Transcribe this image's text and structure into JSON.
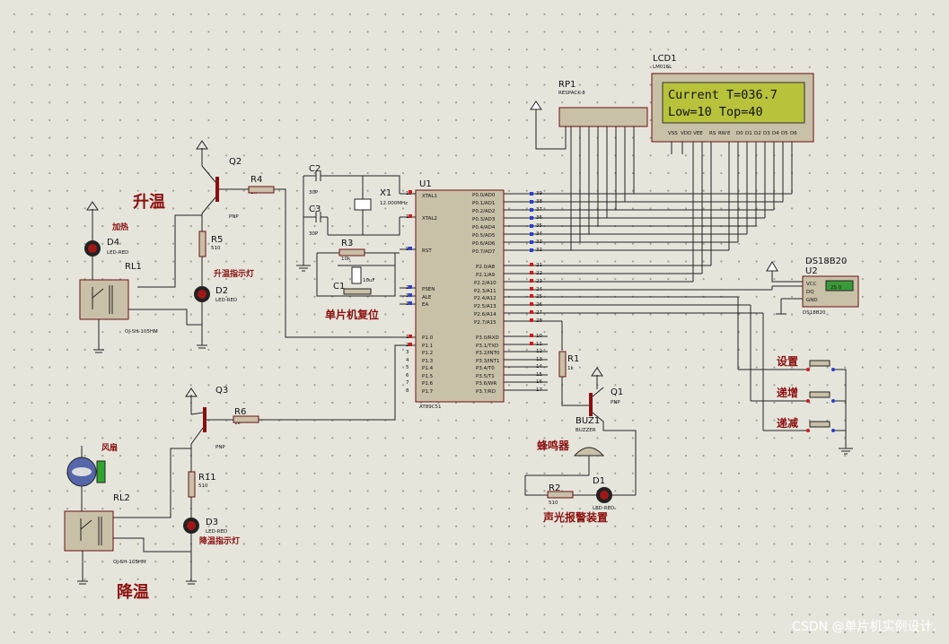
{
  "lcd": {
    "ref": "LCD1",
    "model": "LM016L",
    "line1": "Current T=036.7",
    "line2": " Low=10  Top=40"
  },
  "mcu": {
    "ref": "U1",
    "model": "AT89C51"
  },
  "rp": {
    "ref": "RP1",
    "model": "RESPACK-8"
  },
  "ds18b20": {
    "title": "DS18B20",
    "ref": "U2",
    "display": "25.0",
    "pins": [
      "VCC",
      "DQ",
      "GND"
    ],
    "model": "DS18B20"
  },
  "labels": {
    "heat": "升温",
    "cool": "降温",
    "mcu_reset": "单片机复位",
    "buzzer": "蜂鸣器",
    "alarm": "声光报警装置",
    "setup": "设置",
    "increase": "递增",
    "decrease": "递减",
    "heat_led": "升温指示灯",
    "heater": "加热",
    "cool_led": "降温指示灯",
    "fan": "风扇"
  },
  "components": {
    "q2": "Q2",
    "q3": "Q3",
    "q1": "Q1",
    "r4": "R4",
    "r5": "R5",
    "r6": "R6",
    "r11": "R11",
    "r3": "R3",
    "r1": "R1",
    "r2": "R2",
    "c1": "C1",
    "c2": "C2",
    "c3": "C3",
    "x1": "X1",
    "x1_val": "12.000MHz",
    "d1": "D1",
    "d2": "D2",
    "d3": "D3",
    "d4": "D4",
    "rl1": "RL1",
    "rl2": "RL2",
    "buz1": "BUZ1",
    "buzzer_model": "BUZZER",
    "pnp": "PNP",
    "relay_model": "OJ-SH-105HM",
    "led_red": "LED-RED",
    "r_1k": "1k",
    "r_510": "510",
    "r_10k": "10k",
    "c_30p": "30P",
    "c_10u": "10uF"
  },
  "watermark": "CSDN @单片机实例设计."
}
